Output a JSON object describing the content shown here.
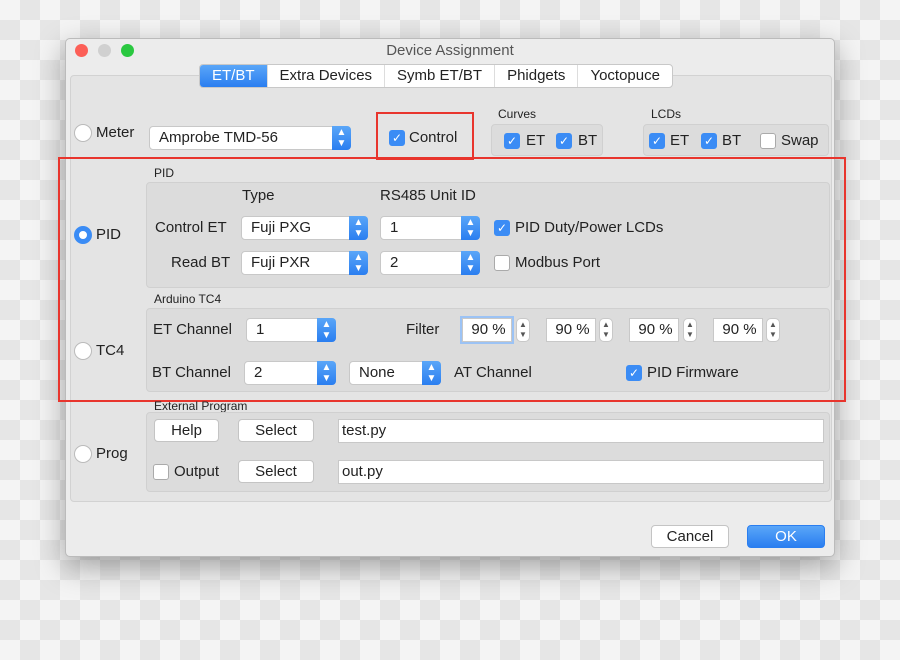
{
  "window": {
    "title": "Device Assignment"
  },
  "tabs": [
    "ET/BT",
    "Extra Devices",
    "Symb ET/BT",
    "Phidgets",
    "Yoctopuce"
  ],
  "meter": {
    "label": "Meter",
    "device": "Amprobe TMD-56",
    "control_label": "Control",
    "control_checked": true
  },
  "curves": {
    "label": "Curves",
    "et": "ET",
    "bt": "BT"
  },
  "lcds": {
    "label": "LCDs",
    "et": "ET",
    "bt": "BT",
    "swap": "Swap"
  },
  "pid": {
    "radio": "PID",
    "group": "PID",
    "type_header": "Type",
    "unit_header": "RS485 Unit ID",
    "control_et": "Control ET",
    "control_type": "Fuji PXG",
    "control_unit": "1",
    "read_bt": "Read BT",
    "read_type": "Fuji PXR",
    "read_unit": "2",
    "duty_lcds": "PID Duty/Power LCDs",
    "modbus": "Modbus Port"
  },
  "tc4": {
    "radio": "TC4",
    "group": "Arduino TC4",
    "et_channel_label": "ET Channel",
    "et_channel": "1",
    "filter_label": "Filter",
    "filters": [
      "90 %",
      "90 %",
      "90 %",
      "90 %"
    ],
    "bt_channel_label": "BT Channel",
    "bt_channel": "2",
    "at_channel": "None",
    "at_channel_label": "AT Channel",
    "pid_firmware": "PID Firmware"
  },
  "prog": {
    "radio": "Prog",
    "group": "External Program",
    "help": "Help",
    "select1": "Select",
    "program": "test.py",
    "output": "Output",
    "select2": "Select",
    "output_file": "out.py"
  },
  "buttons": {
    "cancel": "Cancel",
    "ok": "OK"
  },
  "colors": {
    "accent": "#3b8cf5",
    "highlight": "#e8352d"
  }
}
